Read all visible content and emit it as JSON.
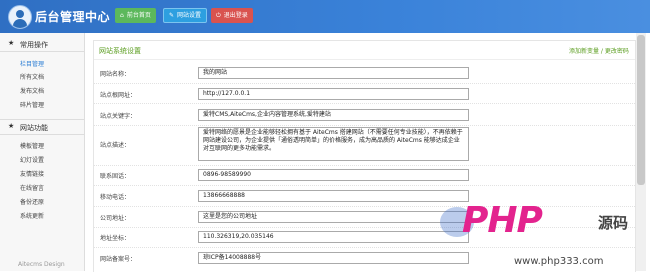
{
  "header": {
    "app_title": "后台管理中心",
    "buttons": [
      {
        "icon": "home-icon",
        "glyph": "⌂",
        "label": "前台首页"
      },
      {
        "icon": "wrench-icon",
        "glyph": "✎",
        "label": "网站设置"
      },
      {
        "icon": "power-icon",
        "glyph": "⏻",
        "label": "退出登录"
      }
    ]
  },
  "sidebar": {
    "sections": [
      {
        "title": "常用操作",
        "items": [
          "栏目管理",
          "所有文档",
          "发布文档",
          "碎片管理"
        ],
        "active_index": 0
      },
      {
        "title": "网站功能",
        "items": [
          "模板管理",
          "幻灯设置",
          "友情链接",
          "在线留言",
          "备份还原",
          "系统更新"
        ]
      }
    ],
    "footer": "Aitecms Design"
  },
  "panel": {
    "title": "网站系统设置",
    "action_link": "添加新变量 / 更改密码"
  },
  "form_rows": [
    {
      "label": "网站名称：",
      "value": "我的网站"
    },
    {
      "label": "站点根网址：",
      "value": "http://127.0.0.1"
    },
    {
      "label": "站点关键字：",
      "value": "爱特CMS,AiteCms,企业内容管理系统,爱特建站"
    },
    {
      "label": "站点描述：",
      "value": "爱特网络的愿景是企业能够轻松拥有基于 AiteCms 搭建网站（不需要任何专业技能），不再依赖于网站建设公司，为企业提供「通俗透明简单」的价格服务，成为高品质的 AiteCms 能够达成企业对互联网的更多功能需求。"
    },
    {
      "label": "联系固话：",
      "value": "0896-98589990"
    },
    {
      "label": "移动电话：",
      "value": "13866668888"
    },
    {
      "label": "公司地址：",
      "value": "这里是您的公司地址"
    },
    {
      "label": "地址坐标：",
      "value": "110.326319,20.035146"
    },
    {
      "label": "网站备案号：",
      "value": "琼ICP备14008888号"
    }
  ],
  "watermark": {
    "brand": "PHP",
    "cn": "源码",
    "url": "www.php333.com"
  },
  "colors": {
    "topbar": "#3a82d9",
    "accent_green": "#5a9d1f",
    "btn_home": "#5cb85c",
    "btn_site": "#2d9fe0",
    "btn_exit": "#d9534f"
  }
}
